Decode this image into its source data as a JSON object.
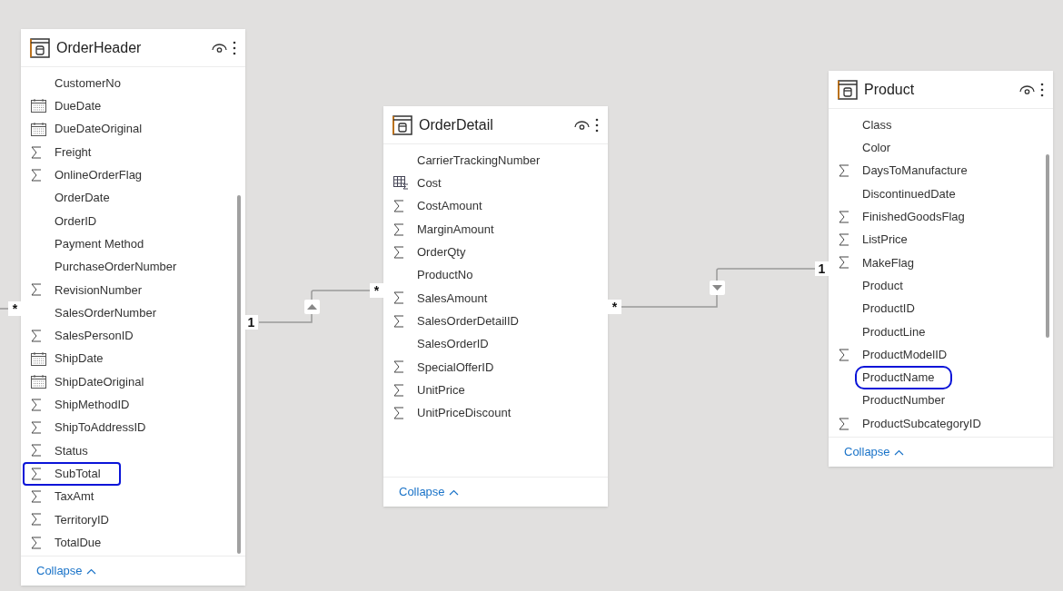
{
  "tables": [
    {
      "title": "OrderHeader",
      "fields": [
        {
          "name": "CustomerNo",
          "kind": "plain",
          "circled": false
        },
        {
          "name": "DueDate",
          "kind": "date",
          "circled": false
        },
        {
          "name": "DueDateOriginal",
          "kind": "date",
          "circled": false
        },
        {
          "name": "Freight",
          "kind": "sum",
          "circled": false
        },
        {
          "name": "OnlineOrderFlag",
          "kind": "sum",
          "circled": false
        },
        {
          "name": "OrderDate",
          "kind": "plain",
          "circled": false
        },
        {
          "name": "OrderID",
          "kind": "plain",
          "circled": false
        },
        {
          "name": "Payment Method",
          "kind": "plain",
          "circled": false
        },
        {
          "name": "PurchaseOrderNumber",
          "kind": "plain",
          "circled": false
        },
        {
          "name": "RevisionNumber",
          "kind": "sum",
          "circled": false
        },
        {
          "name": "SalesOrderNumber",
          "kind": "plain",
          "circled": false
        },
        {
          "name": "SalesPersonID",
          "kind": "sum",
          "circled": false
        },
        {
          "name": "ShipDate",
          "kind": "date",
          "circled": false
        },
        {
          "name": "ShipDateOriginal",
          "kind": "date",
          "circled": false
        },
        {
          "name": "ShipMethodID",
          "kind": "sum",
          "circled": false
        },
        {
          "name": "ShipToAddressID",
          "kind": "sum",
          "circled": false
        },
        {
          "name": "Status",
          "kind": "sum",
          "circled": false
        },
        {
          "name": "SubTotal",
          "kind": "sum",
          "circled": true
        },
        {
          "name": "TaxAmt",
          "kind": "sum",
          "circled": false
        },
        {
          "name": "TerritoryID",
          "kind": "sum",
          "circled": false
        },
        {
          "name": "TotalDue",
          "kind": "sum",
          "circled": false
        }
      ],
      "collapse": "Collapse"
    },
    {
      "title": "OrderDetail",
      "fields": [
        {
          "name": "CarrierTrackingNumber",
          "kind": "plain",
          "circled": false
        },
        {
          "name": "Cost",
          "kind": "measure",
          "circled": false
        },
        {
          "name": "CostAmount",
          "kind": "sum",
          "circled": false
        },
        {
          "name": "MarginAmount",
          "kind": "sum",
          "circled": false
        },
        {
          "name": "OrderQty",
          "kind": "sum",
          "circled": false
        },
        {
          "name": "ProductNo",
          "kind": "plain",
          "circled": false
        },
        {
          "name": "SalesAmount",
          "kind": "sum",
          "circled": false
        },
        {
          "name": "SalesOrderDetailID",
          "kind": "sum",
          "circled": false
        },
        {
          "name": "SalesOrderID",
          "kind": "plain",
          "circled": false
        },
        {
          "name": "SpecialOfferID",
          "kind": "sum",
          "circled": false
        },
        {
          "name": "UnitPrice",
          "kind": "sum",
          "circled": false
        },
        {
          "name": "UnitPriceDiscount",
          "kind": "sum",
          "circled": false
        }
      ],
      "collapse": "Collapse"
    },
    {
      "title": "Product",
      "fields": [
        {
          "name": "Class",
          "kind": "plain",
          "circled": false
        },
        {
          "name": "Color",
          "kind": "plain",
          "circled": false
        },
        {
          "name": "DaysToManufacture",
          "kind": "sum",
          "circled": false
        },
        {
          "name": "DiscontinuedDate",
          "kind": "plain",
          "circled": false
        },
        {
          "name": "FinishedGoodsFlag",
          "kind": "sum",
          "circled": false
        },
        {
          "name": "ListPrice",
          "kind": "sum",
          "circled": false
        },
        {
          "name": "MakeFlag",
          "kind": "sum",
          "circled": false
        },
        {
          "name": "Product",
          "kind": "plain",
          "circled": false
        },
        {
          "name": "ProductID",
          "kind": "plain",
          "circled": false
        },
        {
          "name": "ProductLine",
          "kind": "plain",
          "circled": false
        },
        {
          "name": "ProductModelID",
          "kind": "sum",
          "circled": false
        },
        {
          "name": "ProductName",
          "kind": "plain",
          "circled": true
        },
        {
          "name": "ProductNumber",
          "kind": "plain",
          "circled": false
        },
        {
          "name": "ProductSubcategoryID",
          "kind": "sum",
          "circled": false
        }
      ],
      "collapse": "Collapse"
    }
  ],
  "cardinality_labels": [
    "*",
    "1",
    "*",
    "*",
    "1"
  ],
  "relationships": [
    {
      "kind": "up"
    },
    {
      "kind": "down"
    }
  ]
}
